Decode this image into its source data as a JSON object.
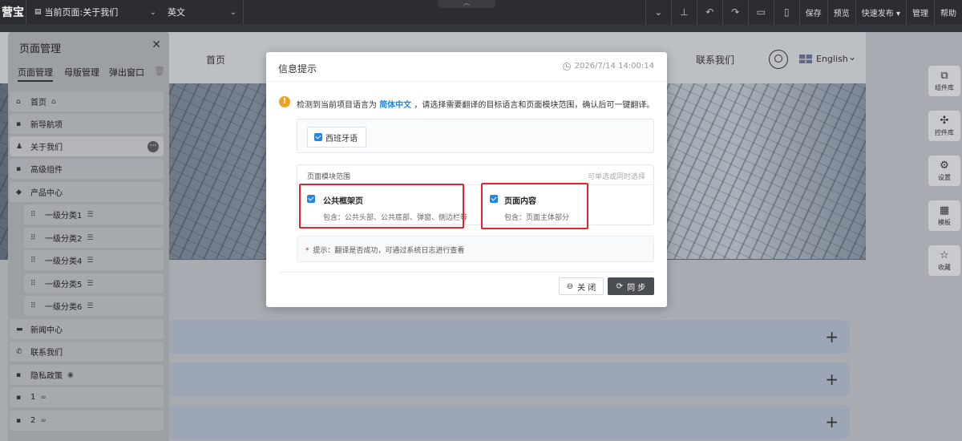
{
  "topbar": {
    "logo_text": "营宝",
    "current_page": "当前页面:关于我们",
    "language": "英文",
    "tools": [
      "保存",
      "预览",
      "快速发布 ▾",
      "管理",
      "帮助"
    ]
  },
  "site": {
    "nav_home": "首页",
    "nav_contact": "联系我们",
    "lang_label": "English"
  },
  "rail": [
    {
      "icon": "component-library-icon",
      "label": "组件库"
    },
    {
      "icon": "control-library-icon",
      "label": "控件库"
    },
    {
      "icon": "settings-icon",
      "label": "设置"
    },
    {
      "icon": "template-icon",
      "label": "模板"
    },
    {
      "icon": "favorites-icon",
      "label": "收藏"
    }
  ],
  "panel": {
    "title": "页面管理",
    "tabs": [
      "页面管理",
      "母版管理",
      "弹出窗口"
    ],
    "items": [
      {
        "label": "首页",
        "icon": "home-icon"
      },
      {
        "label": "新导航项",
        "icon": "page-icon"
      },
      {
        "label": "关于我们",
        "icon": "user-icon"
      },
      {
        "label": "高级组件",
        "icon": "page-icon"
      },
      {
        "label": "产品中心",
        "icon": "folder-icon"
      },
      {
        "label": "一级分类1",
        "icon": "grid-icon"
      },
      {
        "label": "一级分类2",
        "icon": "grid-icon"
      },
      {
        "label": "一级分类4",
        "icon": "grid-icon"
      },
      {
        "label": "一级分类5",
        "icon": "grid-icon"
      },
      {
        "label": "一级分类6",
        "icon": "grid-icon"
      },
      {
        "label": "新闻中心",
        "icon": "news-icon"
      },
      {
        "label": "联系我们",
        "icon": "phone-icon"
      },
      {
        "label": "隐私政策",
        "icon": "page-icon"
      },
      {
        "label": "1",
        "icon": "page-icon"
      },
      {
        "label": "2",
        "icon": "page-icon"
      }
    ]
  },
  "modal": {
    "title": "信息提示",
    "time": "2026/7/14 14:00:14",
    "notice_prefix": "检测到当前项目语言为",
    "notice_lang": "简体中文",
    "notice_suffix": "，请选择需要翻译的目标语言和页面模块范围，确认后可一键翻译。",
    "target_language": "西班牙语",
    "scope_title": "页面模块范围",
    "scope_hint": "可单选或同时选择",
    "option_frame_title": "公共框架页",
    "option_frame_desc": "包含：公共头部、公共底部、弹窗、侧边栏等",
    "option_content_title": "页面内容",
    "option_content_desc": "包含：页面主体部分",
    "tip_star": "*",
    "tip_text": "提示：翻译是否成功，可通过系统日志进行查看",
    "close_label": "关 闭",
    "sync_label": "同 步"
  }
}
